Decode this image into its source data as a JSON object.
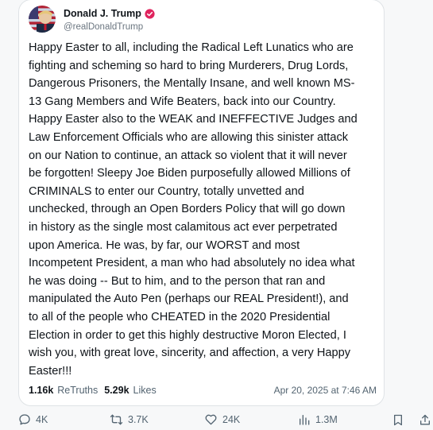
{
  "post": {
    "author": {
      "display_name": "Donald J. Trump",
      "handle": "@realDonaldTrump",
      "verified": true
    },
    "text": "Happy Easter to all, including the Radical Left Lunatics who are\nfighting and scheming so hard to bring Murderers, Drug Lords,\nDangerous Prisoners, the Mentally Insane, and well known MS-\n13 Gang Members and Wife Beaters, back into our Country.\nHappy Easter also to the WEAK and INEFFECTIVE Judges and\nLaw Enforcement Officials who are allowing this sinister attack\non our Nation to continue, an attack so violent that it will never\nbe forgotten! Sleepy Joe Biden purposefully allowed Millions of\nCRIMINALS to enter our Country, totally unvetted and\nunchecked, through an Open Borders Policy that will go down\nin history as the single most calamitous act ever perpetrated\nupon America. He was, by far, our WORST and most\nIncompetent President, a man who had absolutely no idea what\nhe was doing -- But to him, and to the person that ran and\nmanipulated the Auto Pen (perhaps our REAL President!), and\nto all of the people who CHEATED in the 2020 Presidential\nElection in order to get this highly destructive Moron Elected, I\nwish you, with great love, sincerity, and affection, a very Happy\nEaster!!!",
    "stats": {
      "retruths_count": "1.16k",
      "retruths_label": "ReTruths",
      "likes_count": "5.29k",
      "likes_label": "Likes"
    },
    "timestamp": "Apr 20, 2025 at 7:46 AM"
  },
  "actions": {
    "replies": "4K",
    "reposts": "3.7K",
    "likes": "24K",
    "views": "1.3M"
  },
  "icons": {
    "verified": "verified-badge-icon",
    "reply": "speech-bubble-icon",
    "repost": "repost-arrows-icon",
    "like": "heart-icon",
    "views": "bar-chart-icon",
    "bookmark": "bookmark-icon",
    "share": "share-upload-icon"
  },
  "colors": {
    "verified_badge": "#e0245e",
    "text": "#0f1419",
    "muted": "#536471"
  }
}
